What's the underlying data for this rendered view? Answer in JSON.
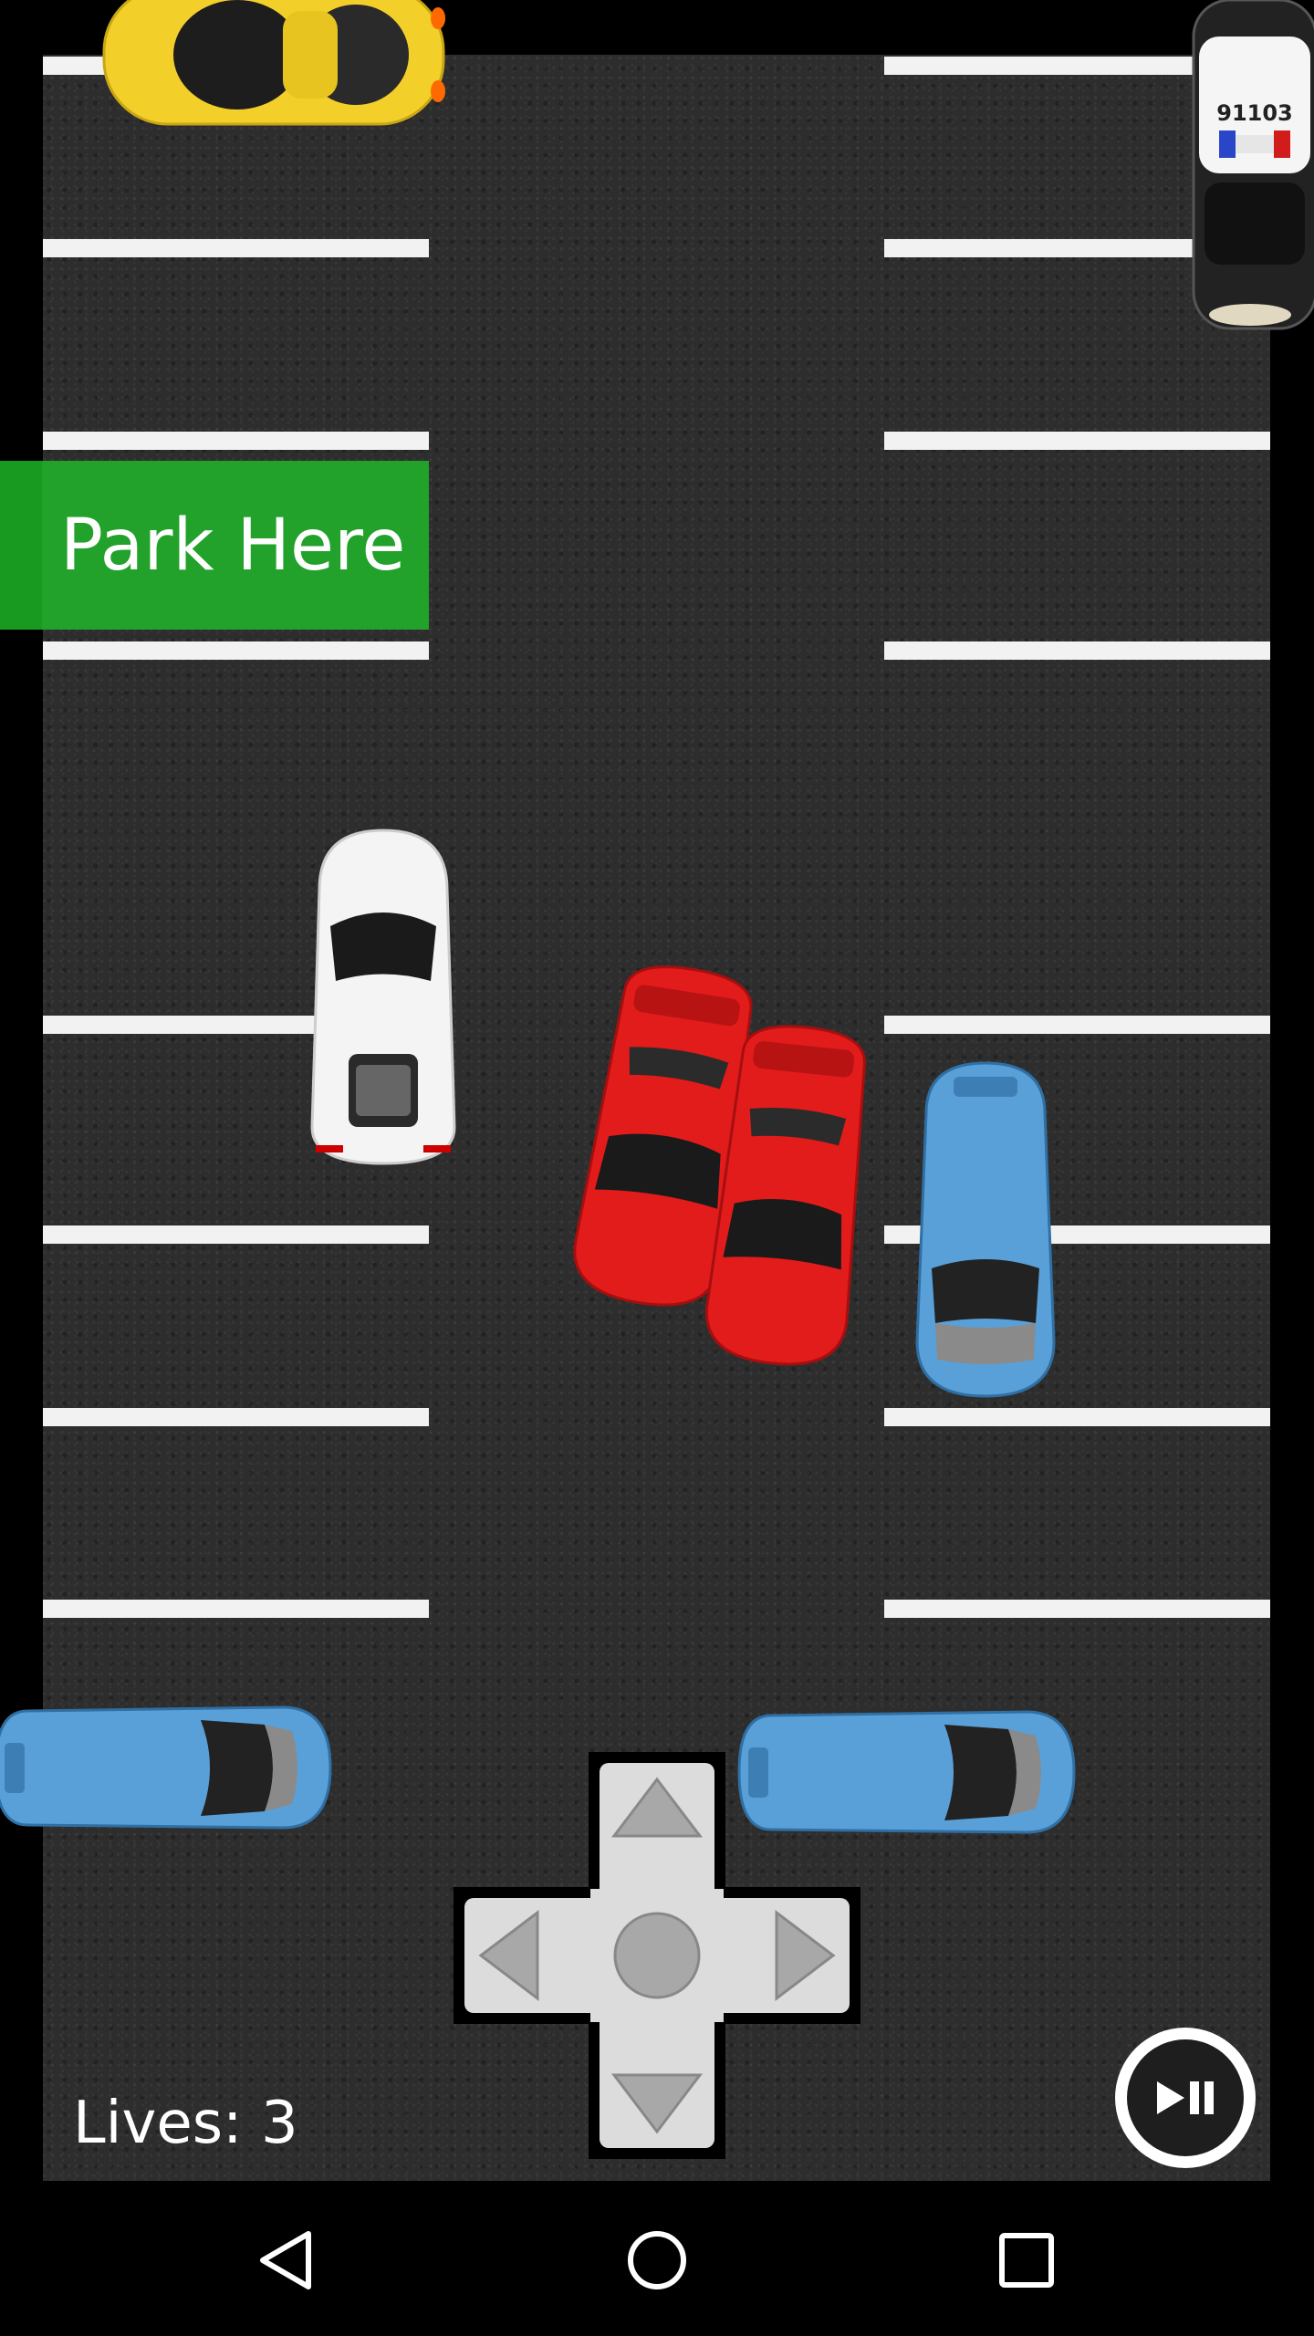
{
  "game": {
    "park_here_label": "Park Here",
    "lives_label": "Lives: 3",
    "police_car_number": "91103"
  },
  "controls": {
    "dpad_icons": [
      "up-arrow-icon",
      "left-arrow-icon",
      "center-circle-icon",
      "right-arrow-icon",
      "down-arrow-icon"
    ],
    "pause_icon": "play-pause-icon"
  },
  "navbar": {
    "icons": [
      "back-icon",
      "home-icon",
      "recents-icon"
    ]
  },
  "colors": {
    "park_here": "#22a12b",
    "red_car": "#e21b1b",
    "blue_car": "#5aa0d8",
    "yellow_car": "#f3cf2a",
    "asphalt": "#2d2d2d"
  }
}
